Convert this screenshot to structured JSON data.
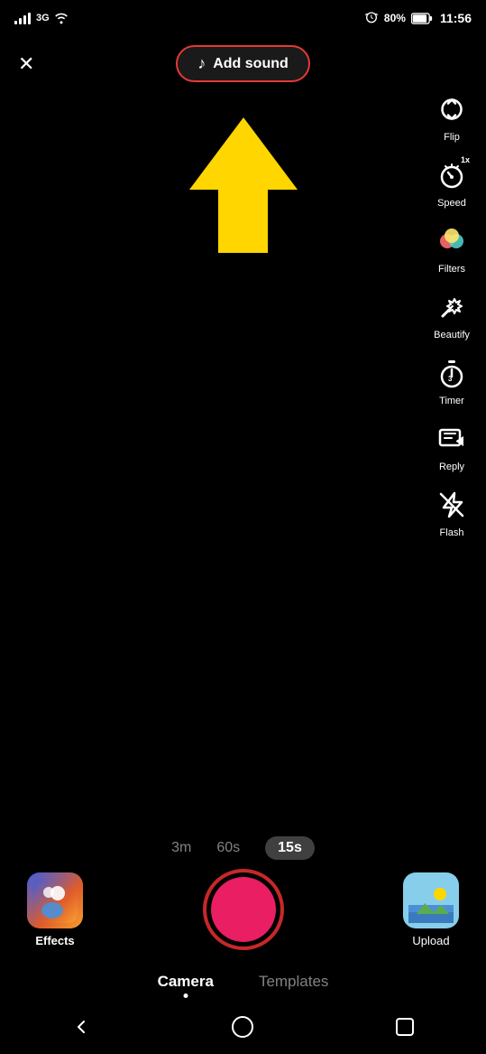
{
  "statusBar": {
    "carrier": "3G",
    "batteryPercent": "80%",
    "time": "11:56"
  },
  "topControls": {
    "closeLabel": "✕",
    "addSoundLabel": "Add sound"
  },
  "rightControls": [
    {
      "id": "flip",
      "label": "Flip",
      "icon": "flip-icon"
    },
    {
      "id": "speed",
      "label": "Speed",
      "icon": "speed-icon",
      "badge": "1x"
    },
    {
      "id": "filters",
      "label": "Filters",
      "icon": "filters-icon"
    },
    {
      "id": "beautify",
      "label": "Beautify",
      "icon": "beautify-icon"
    },
    {
      "id": "timer",
      "label": "Timer",
      "icon": "timer-icon"
    },
    {
      "id": "reply",
      "label": "Reply",
      "icon": "reply-icon"
    },
    {
      "id": "flash",
      "label": "Flash",
      "icon": "flash-icon"
    }
  ],
  "durationOptions": [
    {
      "label": "3m",
      "active": false
    },
    {
      "label": "60s",
      "active": false
    },
    {
      "label": "15s",
      "active": true
    }
  ],
  "bottomControls": {
    "effectsLabel": "Effects",
    "uploadLabel": "Upload"
  },
  "modeTabs": [
    {
      "label": "Camera",
      "active": true
    },
    {
      "label": "Templates",
      "active": false
    }
  ],
  "navBar": {
    "back": "back-icon",
    "home": "home-icon",
    "square": "square-icon"
  }
}
